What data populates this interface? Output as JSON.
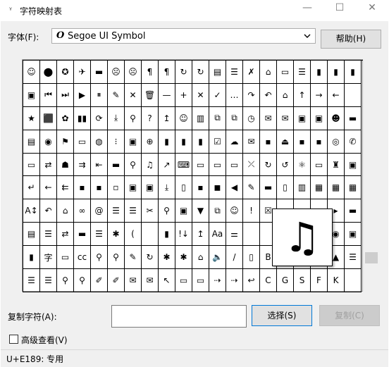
{
  "window": {
    "title": "字符映射表",
    "app_icon_glyph": "ᵞ",
    "minimize_glyph": "—",
    "maximize_glyph": "☐",
    "close_glyph": "✕"
  },
  "font": {
    "label": "字体(F):",
    "selected_glyph": "O",
    "selected": "Segoe UI Symbol"
  },
  "help_button": "帮助(H)",
  "grid": {
    "rows": [
      [
        "☺",
        "⬤",
        "✪",
        "✈",
        "▬",
        "☹",
        "☹",
        "¶",
        "¶",
        "↻",
        "↻",
        "▤",
        "☰",
        "✗",
        "⌂",
        "▭",
        "☰",
        "▮",
        "▮",
        "▮"
      ],
      [
        "▣",
        "⏮",
        "⏭",
        "▶",
        "⏸",
        "✎",
        "✕",
        "🗑",
        "—",
        "+",
        "✕",
        "✓",
        "…",
        "↷",
        "↶",
        "⌂",
        "↑",
        "→",
        "←",
        ""
      ],
      [
        "★",
        "⬛",
        "✿",
        "▮▮",
        "⟳",
        "⤓",
        "⚲",
        "?",
        "↥",
        "☺",
        "▥",
        "⧉",
        "⧉",
        "◷",
        "✉",
        "✉",
        "▣",
        "▣",
        "☻",
        "▬"
      ],
      [
        "▤",
        "◉",
        "⚑",
        "▭",
        "◍",
        "⁝",
        "▣",
        "⊕",
        "▮",
        "▮",
        "▮",
        "☑",
        "☁",
        "✉",
        "▪",
        "⏏",
        "▪",
        "▪",
        "◎",
        "✆"
      ],
      [
        "▭",
        "⇄",
        "☗",
        "⇉",
        "⇤",
        "▬",
        "⚲",
        "♫",
        "↗",
        "⌨",
        "▭",
        "▭",
        "▭",
        "⤫",
        "↻",
        "↺",
        "⚛",
        "▭",
        "♜",
        "▣"
      ],
      [
        "↵",
        "←",
        "⇇",
        "▪",
        "▪",
        "▫",
        "▣",
        "▣",
        "⤓",
        "▯",
        "▪",
        "◼",
        "◀",
        "✎",
        "▬",
        "▯",
        "▥",
        "▦",
        "▦",
        "▦"
      ],
      [
        "A↕",
        "↶",
        "⌂",
        "∞",
        "@",
        "☰",
        "☰",
        "✂",
        "⚲",
        "▣",
        "▼",
        "⧉",
        "☺",
        "!",
        "☒",
        "",
        "",
        "",
        "▸",
        "▬"
      ],
      [
        "▤",
        "☰",
        "⇄",
        "▬",
        "☰",
        "✱",
        "(",
        "",
        "▮",
        "!↓",
        "↥",
        "Aa",
        "⚌",
        "",
        "",
        "",
        "",
        "",
        "◉",
        "▣"
      ],
      [
        "▮",
        "字",
        "▭",
        "cc",
        "⚲",
        "⚲",
        "✎",
        "↻",
        "✱",
        "✱",
        "⌂",
        "🔈",
        "/",
        "▯",
        "B",
        "",
        "",
        "",
        "▲",
        "☰"
      ],
      [
        "☰",
        "☰",
        "⚲",
        "⚲",
        "✐",
        "✐",
        "✉",
        "✉",
        "↖",
        "▭",
        "▭",
        "⇢",
        "⇢",
        "↩",
        "C",
        "G",
        "S",
        "F",
        "K",
        ""
      ]
    ],
    "zoomed_glyph": "♫"
  },
  "copy": {
    "label": "复制字符(A):",
    "value": "",
    "select_button": "选择(S)",
    "copy_button": "复制(C)"
  },
  "advanced_view": {
    "label": "高级查看(V)",
    "checked": false
  },
  "status": "U+E189: 专用"
}
